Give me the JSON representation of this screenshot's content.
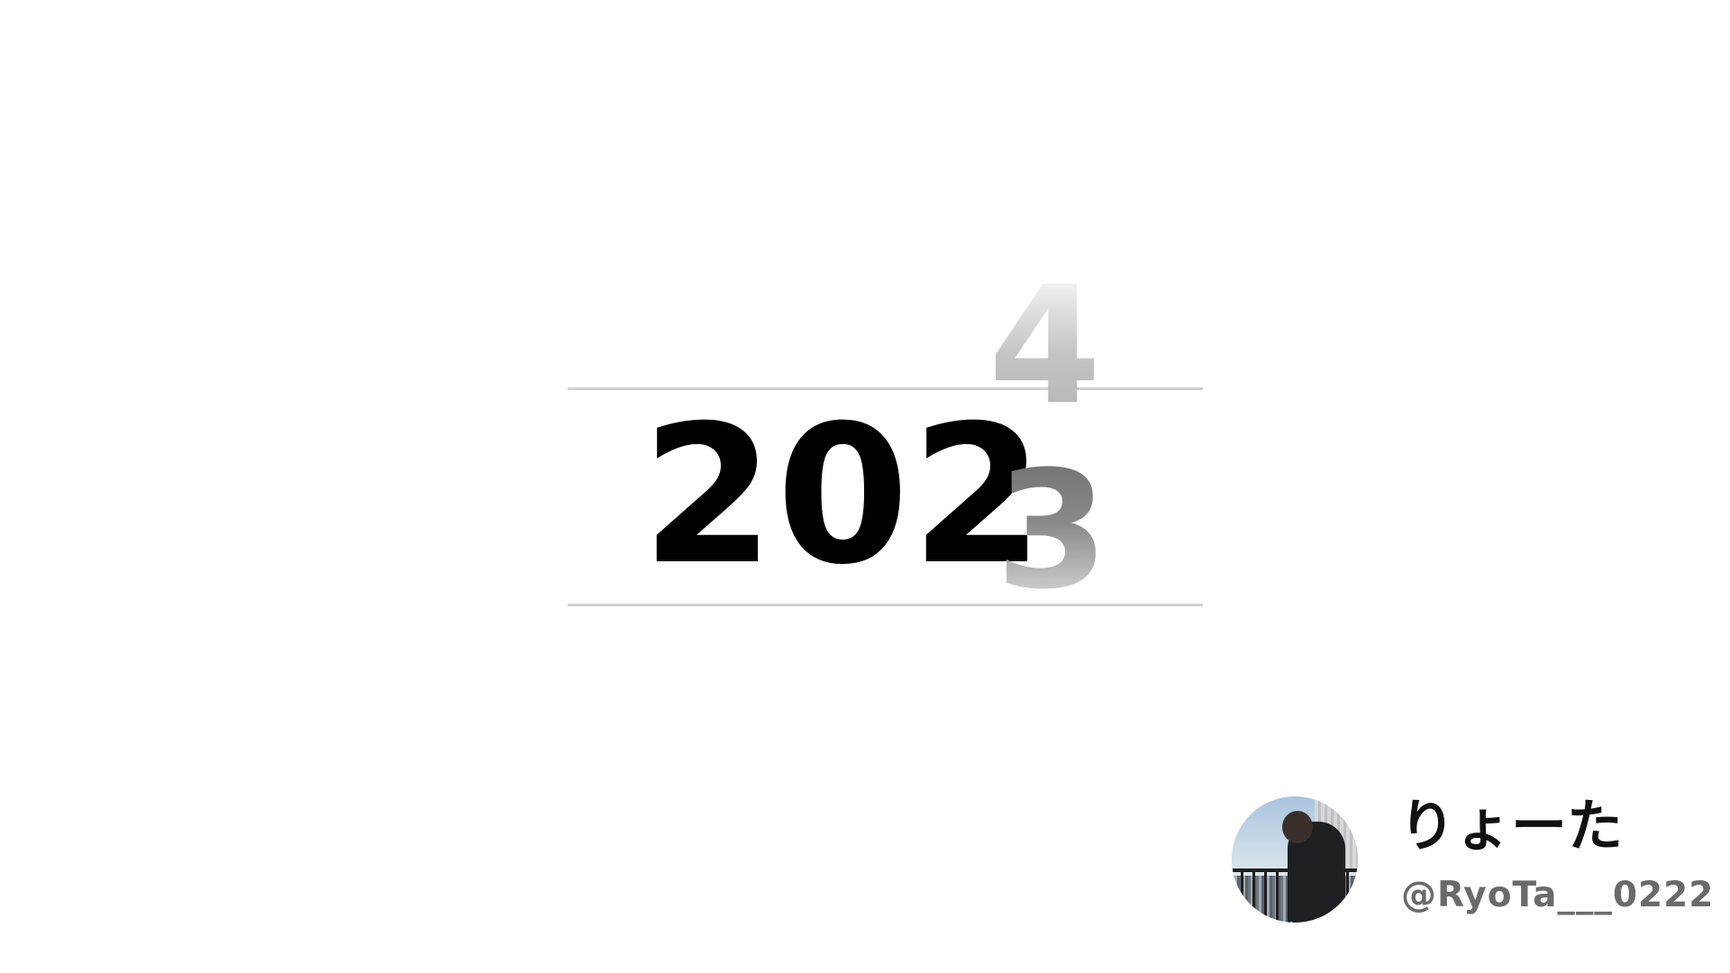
{
  "year_roller": {
    "base": "202",
    "next_digit": "4",
    "current_digit": "3"
  },
  "profile": {
    "display_name": "りょーた",
    "handle": "@RyoTa___0222",
    "avatar_description": "profile-photo"
  },
  "colors": {
    "background": "#ffffff",
    "text_primary": "#000000",
    "guide_line": "#cfcfcf",
    "handle_text": "#6a6a6a"
  }
}
